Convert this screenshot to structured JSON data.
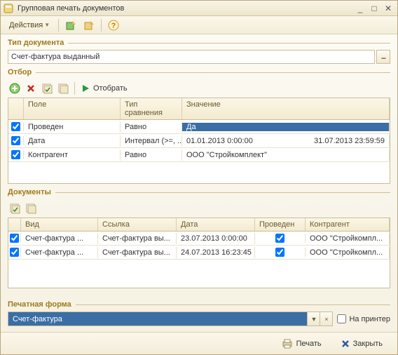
{
  "window": {
    "title": "Групповая печать документов"
  },
  "toolbar": {
    "actions": "Действия"
  },
  "doc_type": {
    "legend": "Тип документа",
    "value": "Счет-фактура выданный"
  },
  "filter": {
    "legend": "Отбор",
    "select_btn": "Отобрать",
    "headers": {
      "field": "Поле",
      "compare": "Тип сравнения",
      "value": "Значение"
    },
    "rows": [
      {
        "checked": true,
        "field": "Проведен",
        "compare": "Равно",
        "value_a": "Да",
        "value_b": ""
      },
      {
        "checked": true,
        "field": "Дата",
        "compare": "Интервал (>=, ...",
        "value_a": "01.01.2013 0:00:00",
        "value_b": "31.07.2013 23:59:59"
      },
      {
        "checked": true,
        "field": "Контрагент",
        "compare": "Равно",
        "value_a": "ООО \"Стройкомплект\"",
        "value_b": ""
      }
    ]
  },
  "docs": {
    "legend": "Документы",
    "headers": {
      "type": "Вид",
      "link": "Ссылка",
      "date": "Дата",
      "posted": "Проведен",
      "partner": "Контрагент"
    },
    "rows": [
      {
        "checked": true,
        "type": "Счет-фактура ...",
        "link": "Счет-фактура вы...",
        "date": "23.07.2013 0:00:00",
        "posted": true,
        "partner": "ООО \"Стройкомпл..."
      },
      {
        "checked": true,
        "type": "Счет-фактура ...",
        "link": "Счет-фактура вы...",
        "date": "24.07.2013 16:23:45",
        "posted": true,
        "partner": "ООО \"Стройкомпл..."
      }
    ]
  },
  "print_form": {
    "legend": "Печатная форма",
    "value": "Счет-фактура",
    "to_printer": "На принтер"
  },
  "footer": {
    "print": "Печать",
    "close": "Закрыть"
  }
}
